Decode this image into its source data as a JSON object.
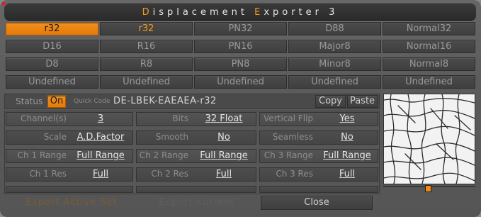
{
  "window": {
    "title_parts": [
      {
        "t": "D",
        "accent": true
      },
      {
        "t": "isplacement  ",
        "accent": false
      },
      {
        "t": "E",
        "accent": true
      },
      {
        "t": "xporter  3",
        "accent": false
      }
    ]
  },
  "presets": {
    "rows": [
      [
        {
          "label": "r32",
          "selected": true
        },
        {
          "label": "r32",
          "orange": true
        },
        {
          "label": "PN32"
        },
        {
          "label": "D88"
        },
        {
          "label": "Normal32"
        }
      ],
      [
        {
          "label": "D16"
        },
        {
          "label": "R16"
        },
        {
          "label": "PN16"
        },
        {
          "label": "Major8"
        },
        {
          "label": "Normal16"
        }
      ],
      [
        {
          "label": "D8"
        },
        {
          "label": "R8"
        },
        {
          "label": "PN8"
        },
        {
          "label": "Minor8"
        },
        {
          "label": "Normal8"
        }
      ],
      [
        {
          "label": "Undefined"
        },
        {
          "label": "Undefined"
        },
        {
          "label": "Undefined"
        },
        {
          "label": "Undefined"
        },
        {
          "label": "Undefined"
        }
      ]
    ]
  },
  "status": {
    "label": "Status",
    "toggle": "On",
    "quick_code_label": "Quick Code",
    "quick_code": "DE-LBEK-EAEAEA-r32",
    "copy": "Copy",
    "paste": "Paste"
  },
  "params": {
    "channels": {
      "label": "Channel(s)",
      "value": "3"
    },
    "bits": {
      "label": "Bits",
      "value": "32 Float"
    },
    "vflip": {
      "label": "Vertical Flip",
      "value": "Yes"
    },
    "scale": {
      "label": "Scale",
      "value": "A.D.Factor"
    },
    "smooth": {
      "label": "Smooth",
      "value": "No"
    },
    "seamless": {
      "label": "Seamless",
      "value": "No"
    },
    "ch1range": {
      "label": "Ch 1 Range",
      "value": "Full Range"
    },
    "ch2range": {
      "label": "Ch 2 Range",
      "value": "Full Range"
    },
    "ch3range": {
      "label": "Ch 3 Range",
      "value": "Full Range"
    },
    "ch1res": {
      "label": "Ch 1 Res",
      "value": "Full"
    },
    "ch2res": {
      "label": "Ch 2 Res",
      "value": "Full"
    },
    "ch3res": {
      "label": "Ch 3 Res",
      "value": "Full"
    }
  },
  "footer": {
    "export_active": "Export Active Set",
    "export_current": "Export current",
    "close": "Close"
  },
  "colors": {
    "accent": "#f39a1e"
  }
}
